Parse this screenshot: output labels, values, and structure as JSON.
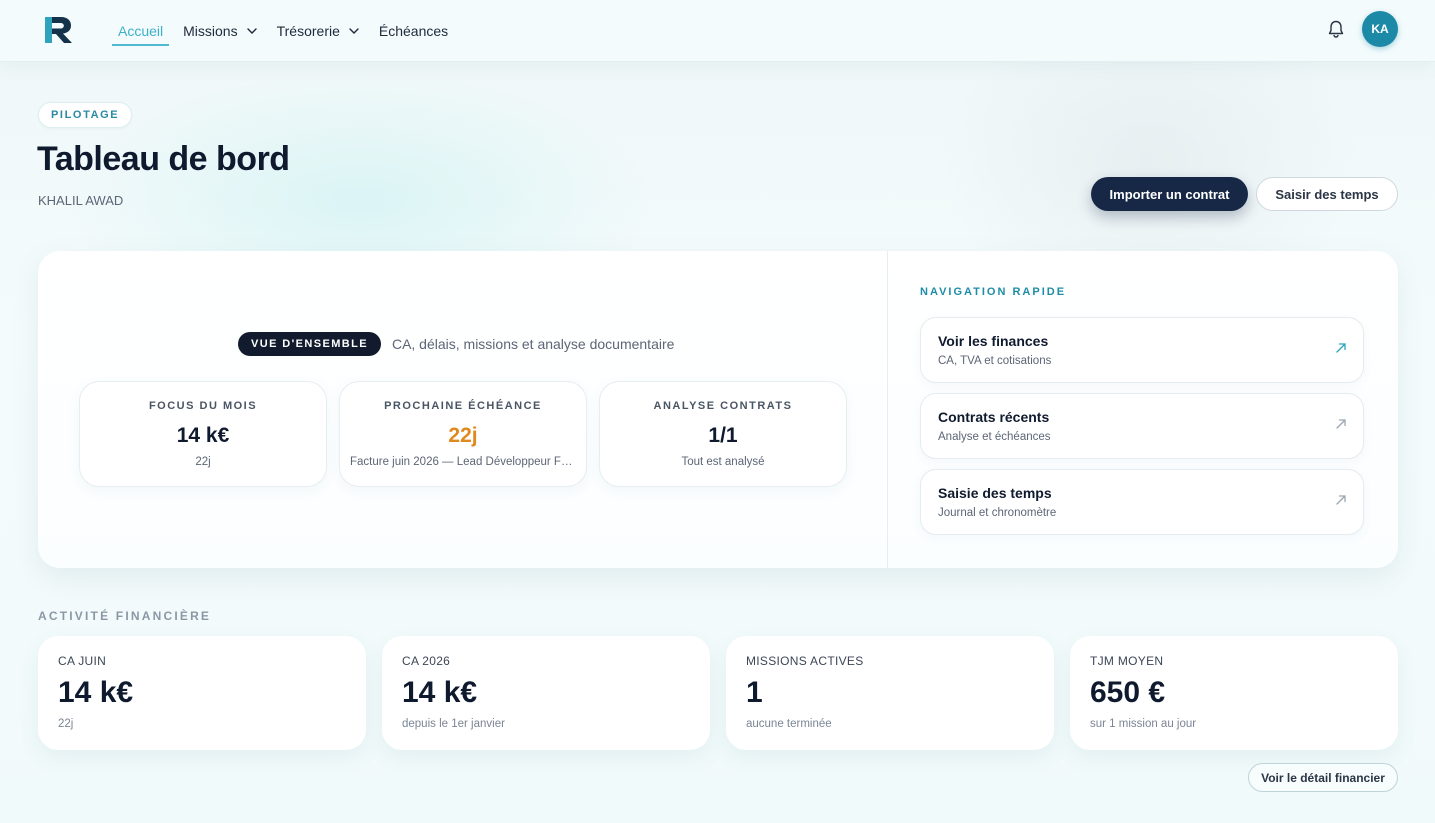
{
  "nav": {
    "items": [
      {
        "label": "Accueil",
        "active": true
      },
      {
        "label": "Missions",
        "dropdown": true
      },
      {
        "label": "Trésorerie",
        "dropdown": true
      },
      {
        "label": "Échéances"
      }
    ],
    "avatar_initials": "KA",
    "icons": {
      "logo": "r-logo",
      "notifications": "bell-icon"
    }
  },
  "header": {
    "tag": "PILOTAGE",
    "title": "Tableau de bord",
    "user_name": "KHALIL AWAD",
    "primary_button": "Importer un contrat",
    "secondary_button": "Saisir des temps"
  },
  "overview": {
    "badge": "VUE D'ENSEMBLE",
    "description": "CA, délais, missions et analyse documentaire",
    "kpis": [
      {
        "label": "FOCUS DU MOIS",
        "value": "14 k€",
        "sub": "22j"
      },
      {
        "label": "PROCHAINE ÉCHÉANCE",
        "value": "22j",
        "sub": "Facture juin 2026 — Lead Développeur Full-Stack",
        "accent": "#e08a1e"
      },
      {
        "label": "ANALYSE CONTRATS",
        "value": "1/1",
        "sub": "Tout est analysé"
      }
    ]
  },
  "quick_nav": {
    "title": "NAVIGATION RAPIDE",
    "items": [
      {
        "title": "Voir les finances",
        "sub": "CA, TVA et cotisations"
      },
      {
        "title": "Contrats récents",
        "sub": "Analyse et échéances"
      },
      {
        "title": "Saisie des temps",
        "sub": "Journal et chronomètre"
      }
    ]
  },
  "financial": {
    "title": "ACTIVITÉ FINANCIÈRE",
    "stats": [
      {
        "label": "CA JUIN",
        "value": "14 k€",
        "sub": "22j"
      },
      {
        "label": "CA 2026",
        "value": "14 k€",
        "sub": "depuis le 1er janvier"
      },
      {
        "label": "MISSIONS ACTIVES",
        "value": "1",
        "sub": "aucune terminée"
      },
      {
        "label": "TJM MOYEN",
        "value": "650 €",
        "sub": "sur 1 mission au jour"
      }
    ],
    "detail_button": "Voir le détail financier"
  },
  "colors": {
    "accent": "#3fb0c9",
    "primary": "#172846",
    "orange": "#e08a1e",
    "avatar": "#1c8aa7"
  }
}
